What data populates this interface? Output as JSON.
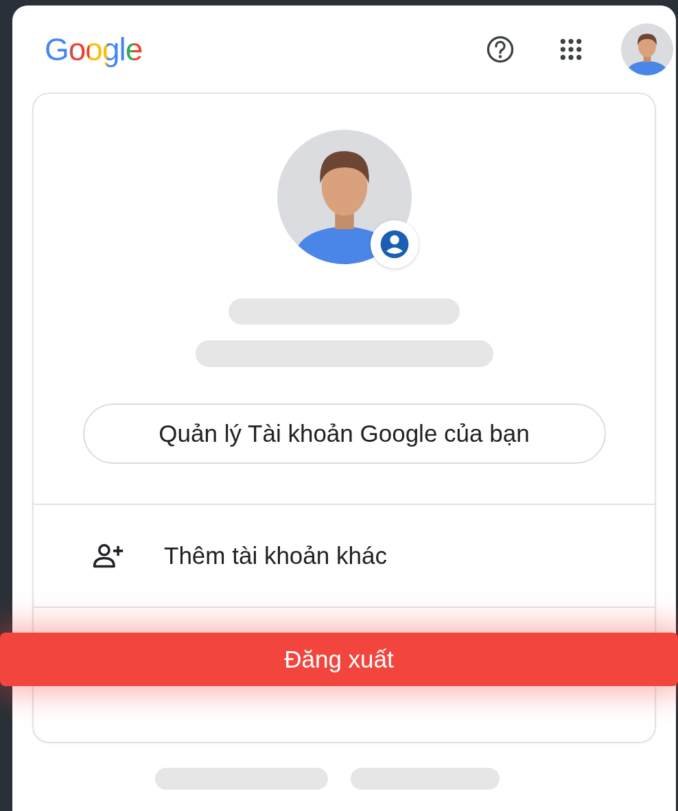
{
  "header": {
    "logo": "Google"
  },
  "account": {
    "manage_button": "Quản lý Tài khoản Google của bạn"
  },
  "menu": [
    {
      "kind": "add-account",
      "label": "Thêm tài khoản khác"
    }
  ],
  "sign_out": {
    "label": "Đăng xuất"
  }
}
